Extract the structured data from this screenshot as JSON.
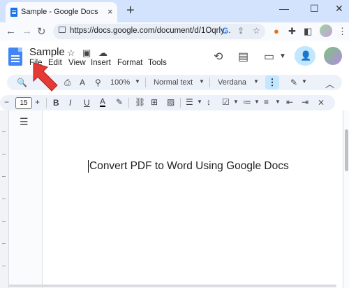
{
  "browser": {
    "tab_title": "Sample - Google Docs",
    "tab_close": "×",
    "new_tab": "+",
    "win_min": "—",
    "win_max": "☐",
    "win_close": "✕",
    "url": "https://docs.google.com/document/d/1Oqrly..."
  },
  "docs": {
    "title": "Sample",
    "menu": [
      "File",
      "Edit",
      "View",
      "Insert",
      "Format",
      "Tools"
    ],
    "toolbar": {
      "zoom": "100%",
      "style": "Normal text",
      "font": "Verdana",
      "font_size": "15"
    },
    "body_text": "Convert PDF to Word Using Google Docs"
  },
  "colors": {
    "accent": "#1a73e8",
    "arrow": "#e53935"
  }
}
